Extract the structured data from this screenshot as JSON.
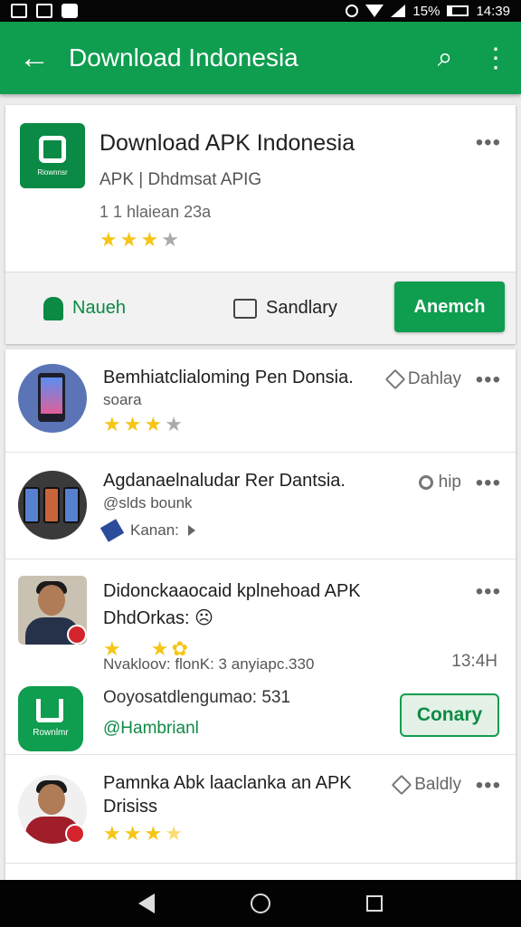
{
  "status_bar": {
    "battery_text": "15%",
    "time": "14:39"
  },
  "app_bar": {
    "title": "Download Indonesia"
  },
  "featured": {
    "title": "Download APK Indonesia",
    "subtitle": "APK  |  Dhdmsat APIG",
    "meta": "1 1 hlaiean 23a",
    "rating": 3.5,
    "actions": {
      "a_label": "Naueh",
      "b_label": "Sandlary",
      "install_label": "Anemch"
    },
    "logo_caption": "Riownnsr"
  },
  "list": [
    {
      "title": "Bemhiatclialoming Pen Donsia.",
      "subtitle": "soara",
      "side_label": "Dahlay",
      "rating": 3
    },
    {
      "title": "Agdanaelnaludar Rer Dantsia.",
      "subtitle": "@slds bounk",
      "side_label": "hip",
      "sub2": "Kanan:"
    },
    {
      "title": "Didonckaaocaid kplnehoad APK",
      "title2": "DhdOrkas: ☹",
      "meta": "Nvakloov: flonK: 3 anyiapc.330",
      "side_time": "13:4H"
    },
    {
      "title": "Ooyosatdlengumao: 531",
      "subtitle": "@Hambrianl",
      "open_label": "Conary",
      "logo_caption": "Rownlmr"
    },
    {
      "title": "Pamnka Abk laaclanka an APK",
      "title2": "Drisiss",
      "side_label": "Baldly",
      "rating": 3.5
    }
  ],
  "colors": {
    "primary": "#0f9d4f",
    "star": "#f5c518"
  },
  "icons": [
    "back-arrow-icon",
    "search-icon",
    "overflow-menu-icon",
    "android-icon",
    "share-icon",
    "pencil-icon",
    "pin-icon",
    "tag-icon",
    "play-icon"
  ]
}
